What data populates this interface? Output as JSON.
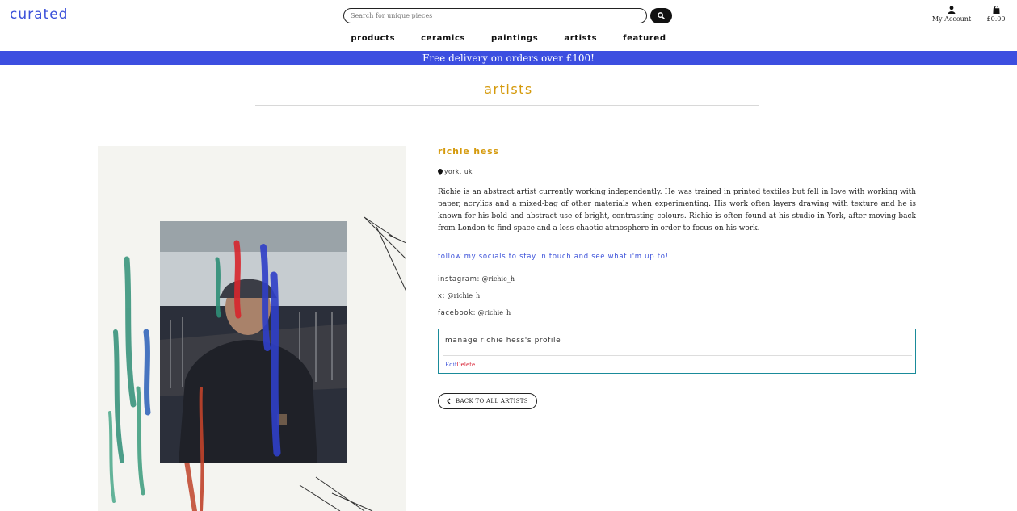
{
  "header": {
    "logo": "curated",
    "search_placeholder": "Search for unique pieces",
    "account_label": "My Account",
    "cart_total": "£0.00"
  },
  "nav": {
    "items": [
      "products",
      "ceramics",
      "paintings",
      "artists",
      "featured"
    ]
  },
  "banner": {
    "text": "Free delivery on orders over £100!"
  },
  "page": {
    "title": "artists"
  },
  "artist": {
    "name": "richie hess",
    "location": "york, uk",
    "bio": "Richie is an abstract artist currently working independently. He was trained in printed textiles but fell in love with working with paper, acrylics and a mixed-bag of other materials when experimenting. His work often layers drawing with texture and he is known for his bold and abstract use of bright, contrasting colours. Richie is often found at his studio in York, after moving back from London to find space and a less chaotic atmosphere in order to focus on his work.",
    "follow_text": "follow my socials to stay in touch and see what i'm up to!",
    "socials": [
      {
        "label": "instagram:",
        "handle": "@richie_h"
      },
      {
        "label": "x:",
        "handle": "@richie_h"
      },
      {
        "label": "facebook:",
        "handle": "@richie_h"
      }
    ]
  },
  "manage": {
    "title": "manage richie hess's profile",
    "edit_label": "Edit",
    "delete_label": "Delete"
  },
  "back_button": {
    "label": "BACK TO ALL ARTISTS"
  },
  "colors": {
    "brand_blue": "#3a50d9",
    "banner_blue": "#3c4ee0",
    "gold": "#d59a0c",
    "teal_border": "#1a8b9a",
    "delete_red": "#d9283a"
  }
}
